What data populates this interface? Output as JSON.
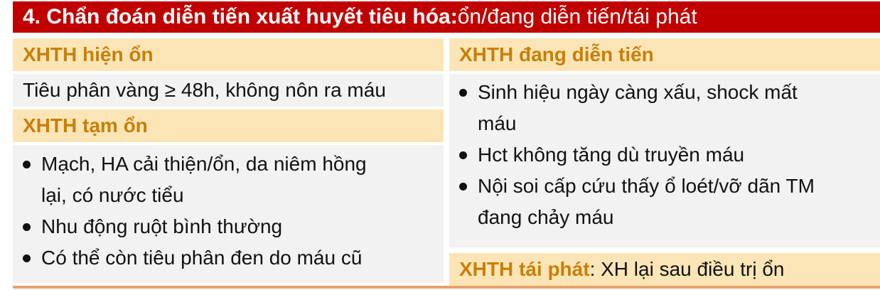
{
  "title": {
    "bold": "4. Chẩn đoán diễn tiến xuất huyết tiêu hóa:",
    "rest": " ổn/đang diễn tiến/tái phát"
  },
  "stable": {
    "heading": "XHTH hiện ổn",
    "text": "Tiêu phân vàng ≥ 48h, không nôn ra máu"
  },
  "temp_stable": {
    "heading": "XHTH tạm ổn",
    "items": [
      {
        "lines": [
          "Mạch, HA cải thiện/ổn, da niêm hồng",
          "lại, có nước tiểu"
        ]
      },
      {
        "lines": [
          "Nhu động ruột bình thường"
        ]
      },
      {
        "lines": [
          "Có thể còn tiêu phân đen do máu cũ"
        ]
      }
    ]
  },
  "progressing": {
    "heading": "XHTH đang diễn tiến",
    "items": [
      {
        "lines": [
          "Sinh hiệu ngày càng xấu, shock mất",
          "máu"
        ]
      },
      {
        "lines": [
          "Hct không tăng dù truyền máu"
        ]
      },
      {
        "lines": [
          "Nội soi cấp cứu thấy ổ loét/vỡ dãn TM",
          "đang chảy máu"
        ]
      }
    ]
  },
  "recurrent": {
    "heading": "XHTH tái phát",
    "text": ": XH lại sau điều trị ổn"
  }
}
